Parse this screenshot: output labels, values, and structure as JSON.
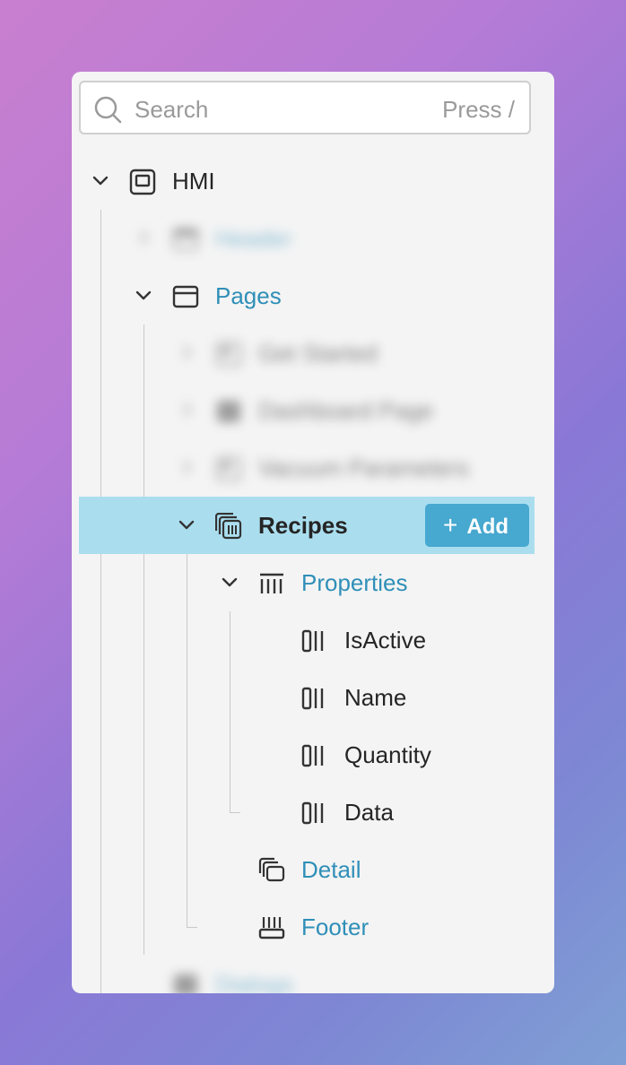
{
  "search": {
    "placeholder": "Search",
    "shortcut_hint": "Press /"
  },
  "tree": {
    "root": {
      "label": "HMI"
    },
    "header": {
      "label": "Header"
    },
    "pages": {
      "label": "Pages"
    },
    "pages_children": [
      {
        "label": "Get Started"
      },
      {
        "label": "Dashboard Page"
      },
      {
        "label": "Vacuum Parameters"
      }
    ],
    "recipes": {
      "label": "Recipes",
      "add_label": "Add"
    },
    "properties": {
      "label": "Properties"
    },
    "property_items": [
      {
        "label": "IsActive"
      },
      {
        "label": "Name"
      },
      {
        "label": "Quantity"
      },
      {
        "label": "Data"
      }
    ],
    "detail": {
      "label": "Detail"
    },
    "footer": {
      "label": "Footer"
    },
    "bottom": {
      "label": "Dialogs"
    }
  },
  "colors": {
    "accent": "#2f8fb8",
    "selection": "#aadeef",
    "button": "#47a8d0"
  }
}
